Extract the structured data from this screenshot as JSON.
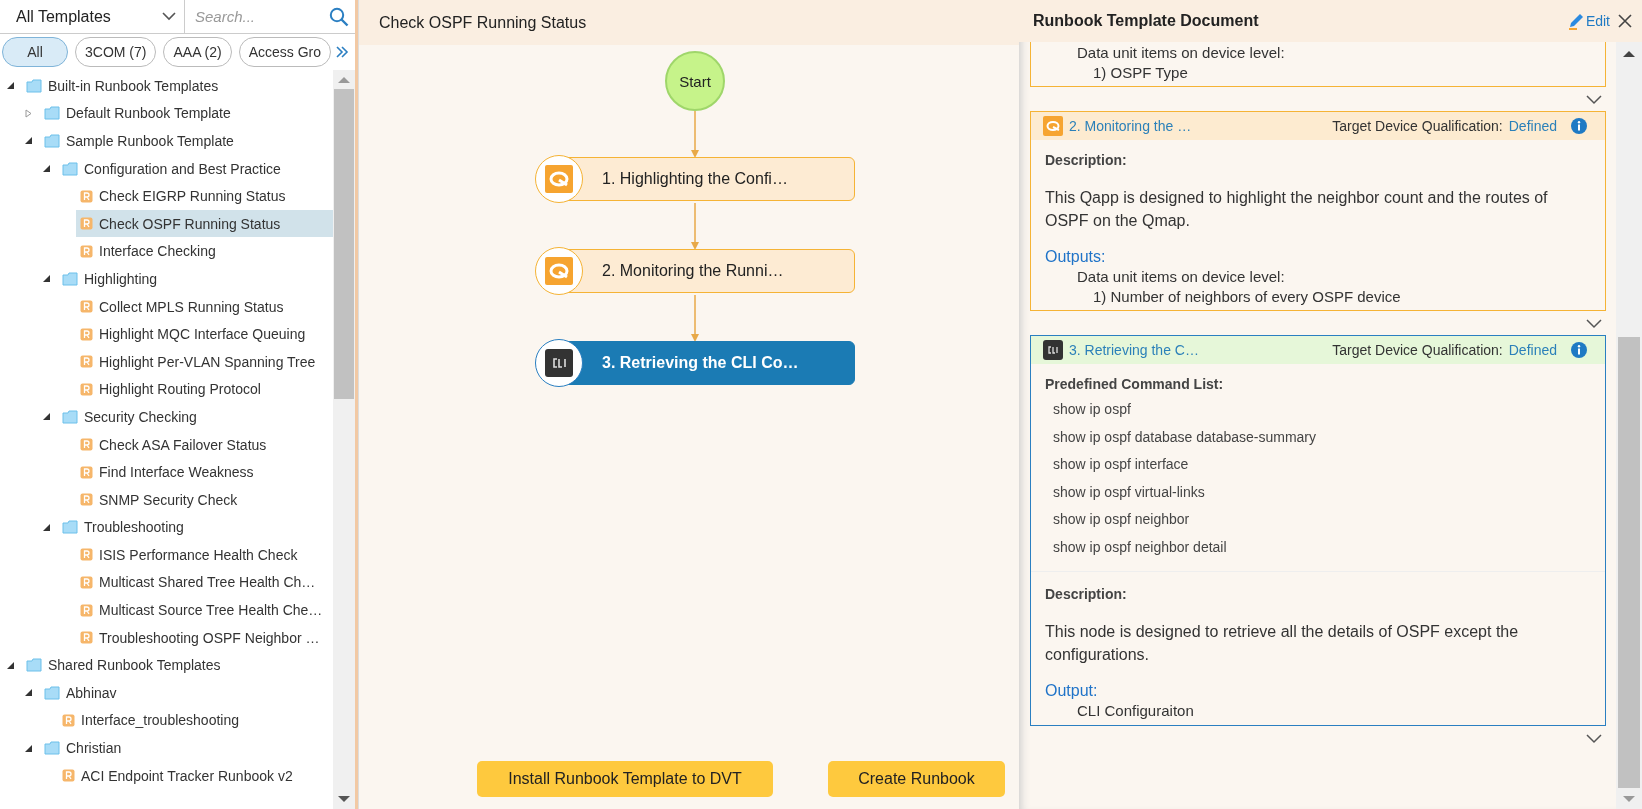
{
  "left": {
    "filter": {
      "value": "All Templates"
    },
    "search": {
      "placeholder": "Search..."
    },
    "chips": [
      {
        "label": "All",
        "selected": true
      },
      {
        "label": "3COM (7)",
        "selected": false
      },
      {
        "label": "AAA (2)",
        "selected": false
      },
      {
        "label": "Access Gro",
        "selected": false
      }
    ],
    "tree": [
      {
        "kind": "folder",
        "label": "Built-in Runbook Templates",
        "expanded": true,
        "selected": false,
        "children": [
          {
            "kind": "folder",
            "label": "Default Runbook Template",
            "expanded": false,
            "selected": false
          },
          {
            "kind": "folder",
            "label": "Sample Runbook Template",
            "expanded": true,
            "selected": false,
            "children": [
              {
                "kind": "folder",
                "label": "Configuration and Best Practice",
                "expanded": true,
                "selected": false,
                "children": [
                  {
                    "kind": "runbook",
                    "label": "Check EIGRP Running Status",
                    "selected": false
                  },
                  {
                    "kind": "runbook",
                    "label": "Check OSPF Running Status",
                    "selected": true
                  },
                  {
                    "kind": "runbook",
                    "label": "Interface Checking",
                    "selected": false
                  }
                ]
              },
              {
                "kind": "folder",
                "label": "Highlighting",
                "expanded": true,
                "selected": false,
                "children": [
                  {
                    "kind": "runbook",
                    "label": "Collect MPLS Running Status",
                    "selected": false
                  },
                  {
                    "kind": "runbook",
                    "label": "Highlight MQC Interface Queuing",
                    "selected": false
                  },
                  {
                    "kind": "runbook",
                    "label": "Highlight Per-VLAN Spanning Tree",
                    "selected": false
                  },
                  {
                    "kind": "runbook",
                    "label": "Highlight Routing Protocol",
                    "selected": false
                  }
                ]
              },
              {
                "kind": "folder",
                "label": "Security Checking",
                "expanded": true,
                "selected": false,
                "children": [
                  {
                    "kind": "runbook",
                    "label": "Check ASA Failover Status",
                    "selected": false
                  },
                  {
                    "kind": "runbook",
                    "label": "Find Interface Weakness",
                    "selected": false
                  },
                  {
                    "kind": "runbook",
                    "label": "SNMP Security Check",
                    "selected": false
                  }
                ]
              },
              {
                "kind": "folder",
                "label": "Troubleshooting",
                "expanded": true,
                "selected": false,
                "children": [
                  {
                    "kind": "runbook",
                    "label": "ISIS Performance Health Check",
                    "selected": false
                  },
                  {
                    "kind": "runbook",
                    "label": "Multicast Shared Tree Health Ch…",
                    "selected": false
                  },
                  {
                    "kind": "runbook",
                    "label": "Multicast Source Tree Health Che…",
                    "selected": false
                  },
                  {
                    "kind": "runbook",
                    "label": "Troubleshooting OSPF Neighbor …",
                    "selected": false
                  }
                ]
              }
            ]
          }
        ]
      },
      {
        "kind": "folder",
        "label": "Shared Runbook Templates",
        "expanded": true,
        "selected": false,
        "children": [
          {
            "kind": "folder",
            "label": "Abhinav",
            "expanded": true,
            "selected": false,
            "children": [
              {
                "kind": "runbook",
                "label": "Interface_troubleshooting",
                "selected": false
              }
            ]
          },
          {
            "kind": "folder",
            "label": "Christian",
            "expanded": true,
            "selected": false,
            "children": [
              {
                "kind": "runbook",
                "label": "ACI Endpoint Tracker Runbook v2",
                "selected": false
              }
            ]
          }
        ]
      }
    ]
  },
  "canvas": {
    "title": "Check OSPF Running Status",
    "start": "Start",
    "steps": [
      {
        "kind": "qapp",
        "label": "1. Highlighting the Confi…",
        "selected": false
      },
      {
        "kind": "qapp",
        "label": "2. Monitoring the Runni…",
        "selected": false
      },
      {
        "kind": "cli",
        "label": "3. Retrieving the CLI Co…",
        "selected": true
      }
    ],
    "buttons": [
      "Install Runbook Template to DVT",
      "Create Runbook"
    ]
  },
  "document": {
    "title": "Runbook Template Document",
    "edit": "Edit",
    "cards": [
      {
        "kind": "fragment",
        "selected": false,
        "sections": [
          {
            "kind": "indent",
            "text": "Data unit items on device level:"
          },
          {
            "kind": "indent2",
            "text": "1) OSPF Type"
          }
        ]
      },
      {
        "kind": "qapp",
        "selected": false,
        "title": "2. Monitoring the …",
        "qualification": "Target Device Qualification:",
        "qualification_value": "Defined",
        "sections": [
          {
            "kind": "heading",
            "text": "Description:"
          },
          {
            "kind": "paragraph",
            "text": "This Qapp is designed to highlight the neighbor count and the routes of OSPF on the Qmap."
          },
          {
            "kind": "link",
            "text": "Outputs:"
          },
          {
            "kind": "indent",
            "text": "Data unit items on device level:"
          },
          {
            "kind": "indent2",
            "text": "1) Number of neighbors of every OSPF device"
          }
        ]
      },
      {
        "kind": "cli",
        "selected": true,
        "title": "3. Retrieving the C…",
        "qualification": "Target Device Qualification:",
        "qualification_value": "Defined",
        "sections": [
          {
            "kind": "heading",
            "text": "Predefined Command List:"
          },
          {
            "kind": "command",
            "text": "show ip ospf"
          },
          {
            "kind": "command",
            "text": "show ip ospf database database-summary"
          },
          {
            "kind": "command",
            "text": "show ip ospf interface"
          },
          {
            "kind": "command",
            "text": "show ip ospf virtual-links"
          },
          {
            "kind": "command",
            "text": "show ip ospf neighbor"
          },
          {
            "kind": "command",
            "text": "show ip ospf neighbor detail"
          },
          {
            "kind": "heading",
            "text": "Description:"
          },
          {
            "kind": "paragraph",
            "text": "This node is designed to retrieve all the details of OSPF except the configurations."
          },
          {
            "kind": "link",
            "text": "Output:"
          },
          {
            "kind": "indent",
            "text": "CLI Configuraiton"
          }
        ]
      }
    ]
  }
}
